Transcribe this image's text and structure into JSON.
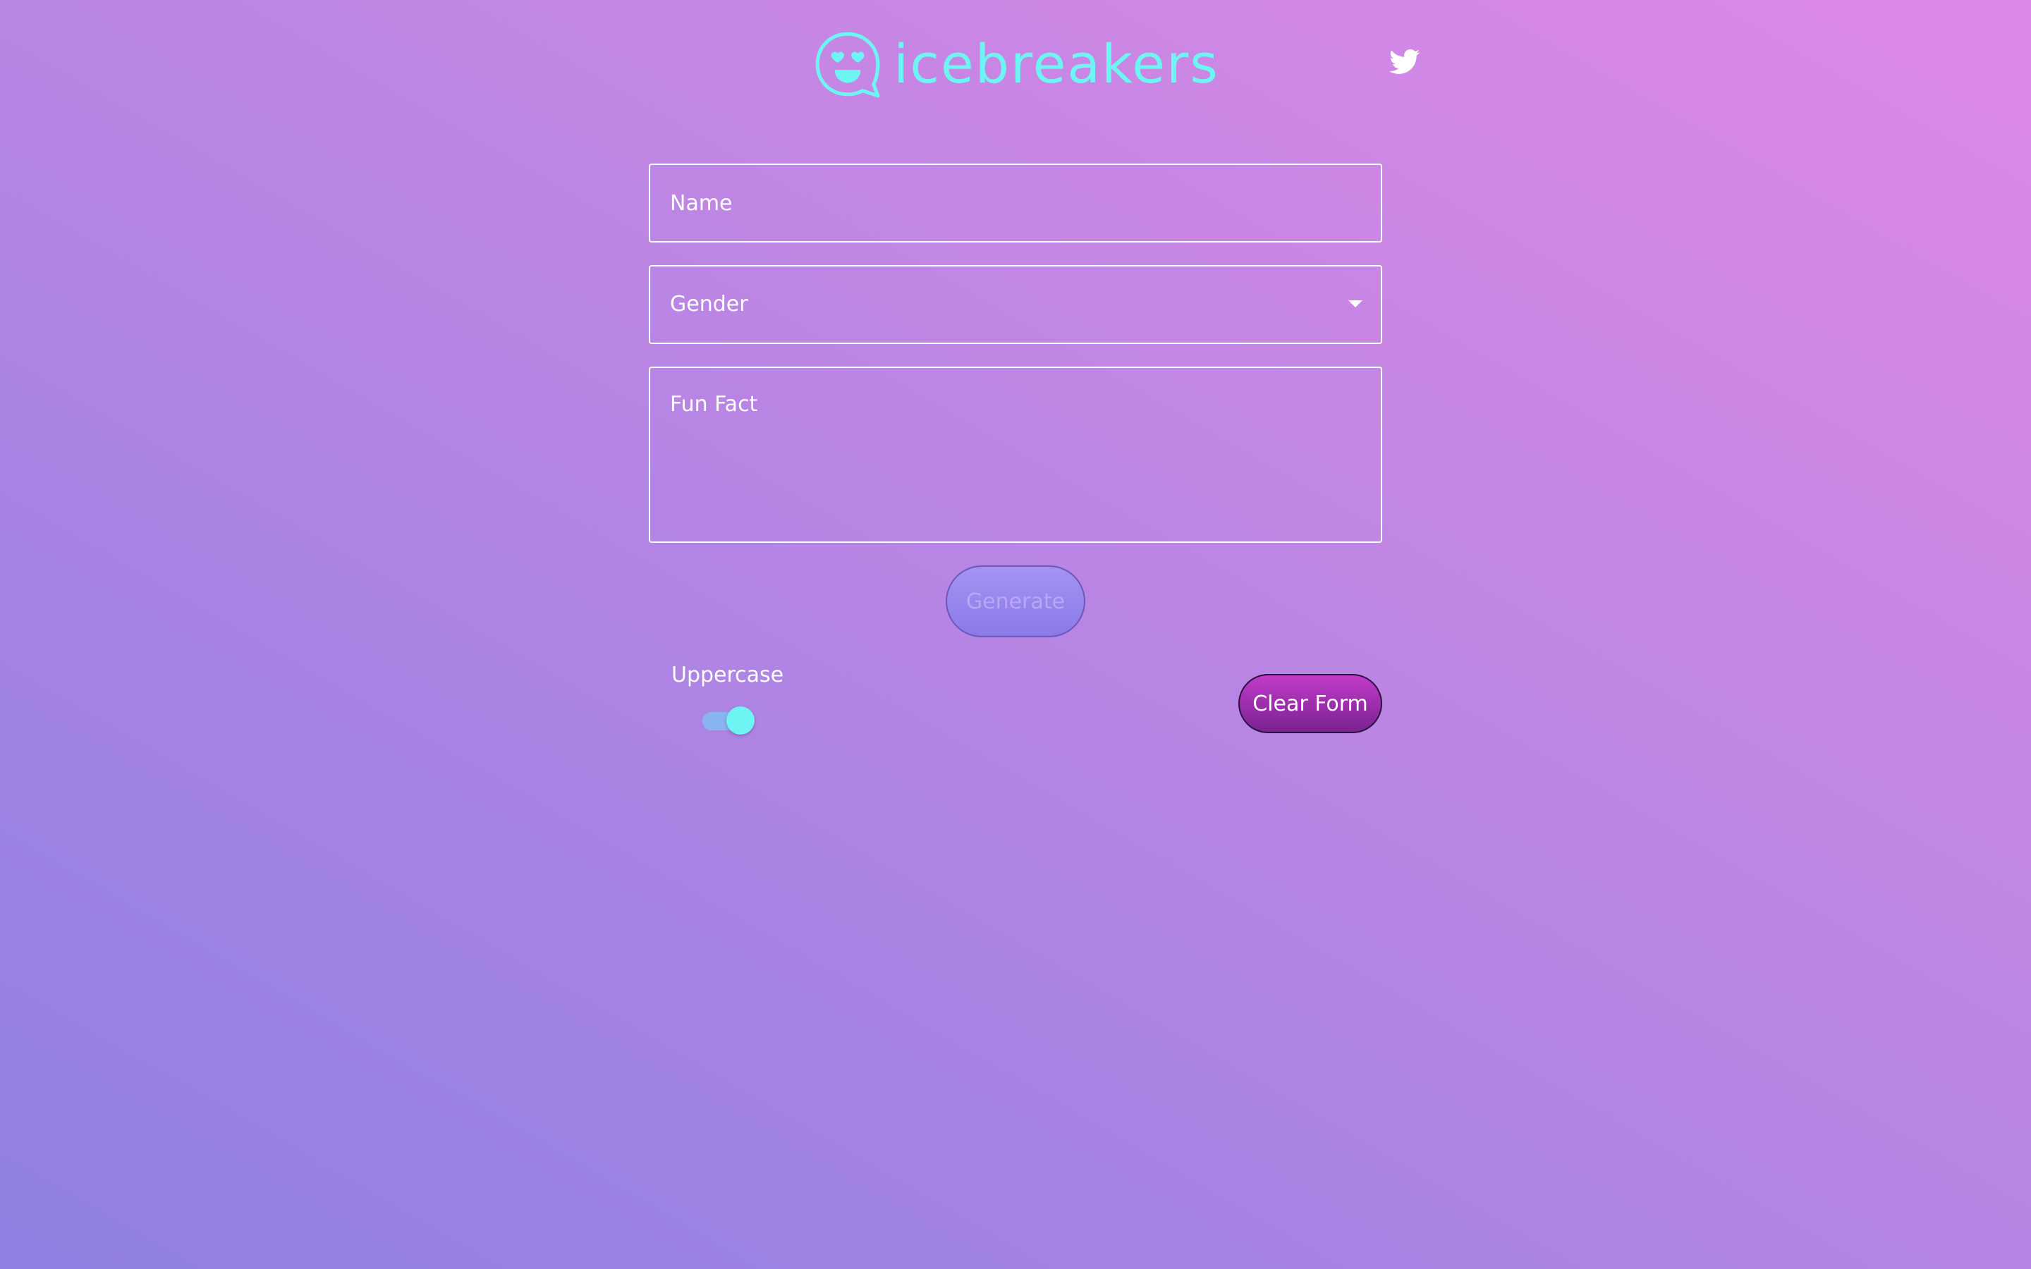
{
  "header": {
    "brand_name": "icebreakers",
    "logo_icon": "heart-eyes-chat-bubble-icon",
    "twitter_icon": "twitter-icon"
  },
  "form": {
    "name_placeholder": "Name",
    "name_value": "",
    "gender_selected": "Gender",
    "fun_fact_placeholder": "Fun Fact",
    "fun_fact_value": "",
    "generate_label": "Generate",
    "uppercase_label": "Uppercase",
    "uppercase_enabled": true,
    "clear_label": "Clear Form"
  },
  "colors": {
    "accent": "#6ef4f2",
    "background_start": "#8f7fe0",
    "background_end": "#dd88e6",
    "clear_button": "#a12dad",
    "generate_button": "#9888ed"
  }
}
